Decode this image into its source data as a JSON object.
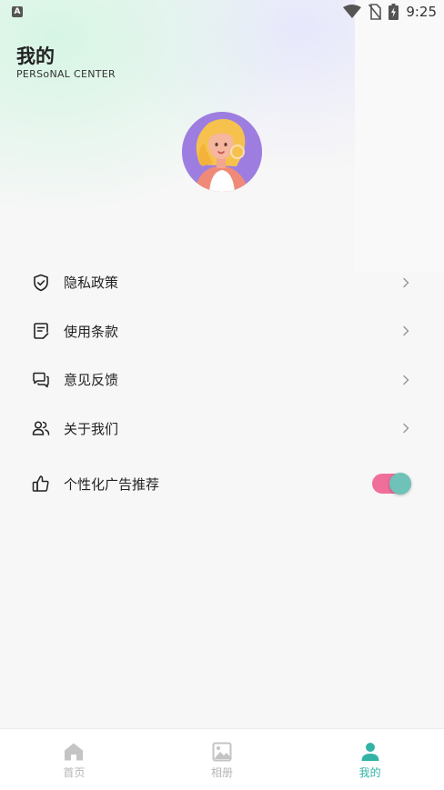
{
  "status_bar": {
    "app_icon_letter": "A",
    "time": "9:25"
  },
  "header": {
    "title": "我的",
    "subtitle": "PERSoNAL CENTER"
  },
  "menu": {
    "items": [
      {
        "label": "隐私政策",
        "icon": "shield-check-icon"
      },
      {
        "label": "使用条款",
        "icon": "document-edit-icon"
      },
      {
        "label": "意见反馈",
        "icon": "chat-bubbles-icon"
      },
      {
        "label": "关于我们",
        "icon": "users-icon"
      }
    ],
    "toggle_item": {
      "label": "个性化广告推荐",
      "icon": "thumbs-up-icon",
      "enabled": true
    }
  },
  "bottom_nav": {
    "items": [
      {
        "label": "首页",
        "icon": "home-icon",
        "active": false
      },
      {
        "label": "相册",
        "icon": "image-icon",
        "active": false
      },
      {
        "label": "我的",
        "icon": "person-icon",
        "active": true
      }
    ]
  },
  "colors": {
    "accent": "#33b3a6",
    "nav_inactive": "#b5b5b5",
    "toggle_track": "#f06f9a",
    "toggle_knob": "#6ec2b8",
    "avatar_bg": "#9d7ee0"
  }
}
